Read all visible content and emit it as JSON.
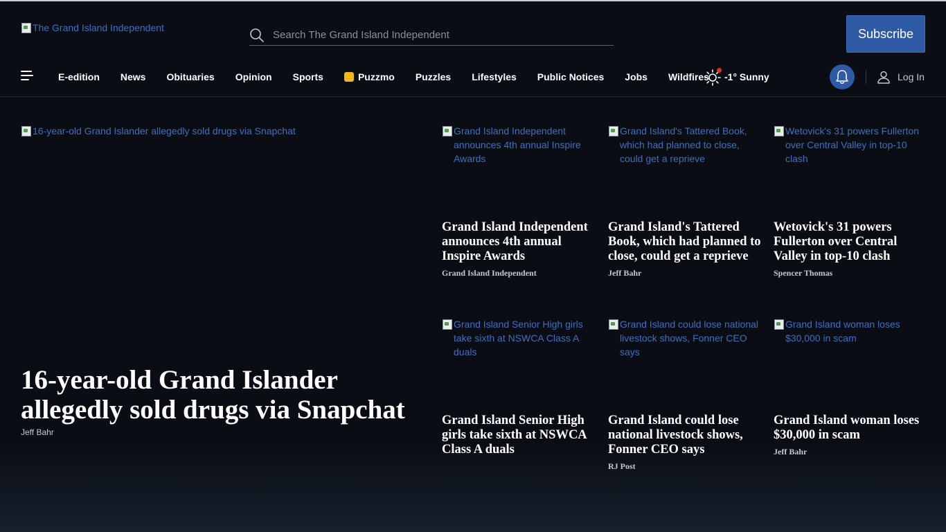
{
  "header": {
    "logo_alt": "The Grand Island Independent",
    "search_placeholder": "Search The Grand Island Independent",
    "subscribe_label": "Subscribe"
  },
  "nav": {
    "items": [
      "E-edition",
      "News",
      "Obituaries",
      "Opinion",
      "Sports",
      "Puzzmo",
      "Puzzles",
      "Lifestyles",
      "Public Notices",
      "Jobs",
      "Wildfires"
    ],
    "weather": "-1° Sunny",
    "login_label": "Log In"
  },
  "lead": {
    "image_alt": "16-year-old Grand Islander allegedly sold drugs via Snapchat",
    "title": "16-year-old Grand Islander allegedly sold drugs via Snapchat",
    "author": "Jeff Bahr"
  },
  "cards": [
    {
      "image_alt": "Grand Island Independent announces 4th annual Inspire Awards",
      "title": "Grand Island Independent announces 4th annual Inspire Awards",
      "author": "Grand Island Independent"
    },
    {
      "image_alt": "Grand Island's Tattered Book, which had planned to close, could get a reprieve",
      "title": "Grand Island's Tattered Book, which had planned to close, could get a reprieve",
      "author": "Jeff Bahr"
    },
    {
      "image_alt": "Wetovick's 31 powers Fullerton over Central Valley in top-10 clash",
      "title": "Wetovick's 31 powers Fullerton over Central Valley in top-10 clash",
      "author": "Spencer Thomas"
    },
    {
      "image_alt": "Grand Island Senior High girls take sixth at NSWCA Class A duals",
      "title": "Grand Island Senior High girls take sixth at NSWCA Class A duals",
      "author": ""
    },
    {
      "image_alt": "Grand Island could lose national livestock shows, Fonner CEO says",
      "title": "Grand Island could lose national livestock shows, Fonner CEO says",
      "author": "RJ Post"
    },
    {
      "image_alt": "Grand Island woman loses $30,000 in scam",
      "title": "Grand Island woman loses $30,000 in scam",
      "author": "Jeff Bahr"
    }
  ],
  "colors": {
    "background": "#0a0d13",
    "accent": "#2f5ba6",
    "link": "#3f6fc1",
    "puzzmo": "#f3b817",
    "alert_dot": "#e0302e"
  }
}
